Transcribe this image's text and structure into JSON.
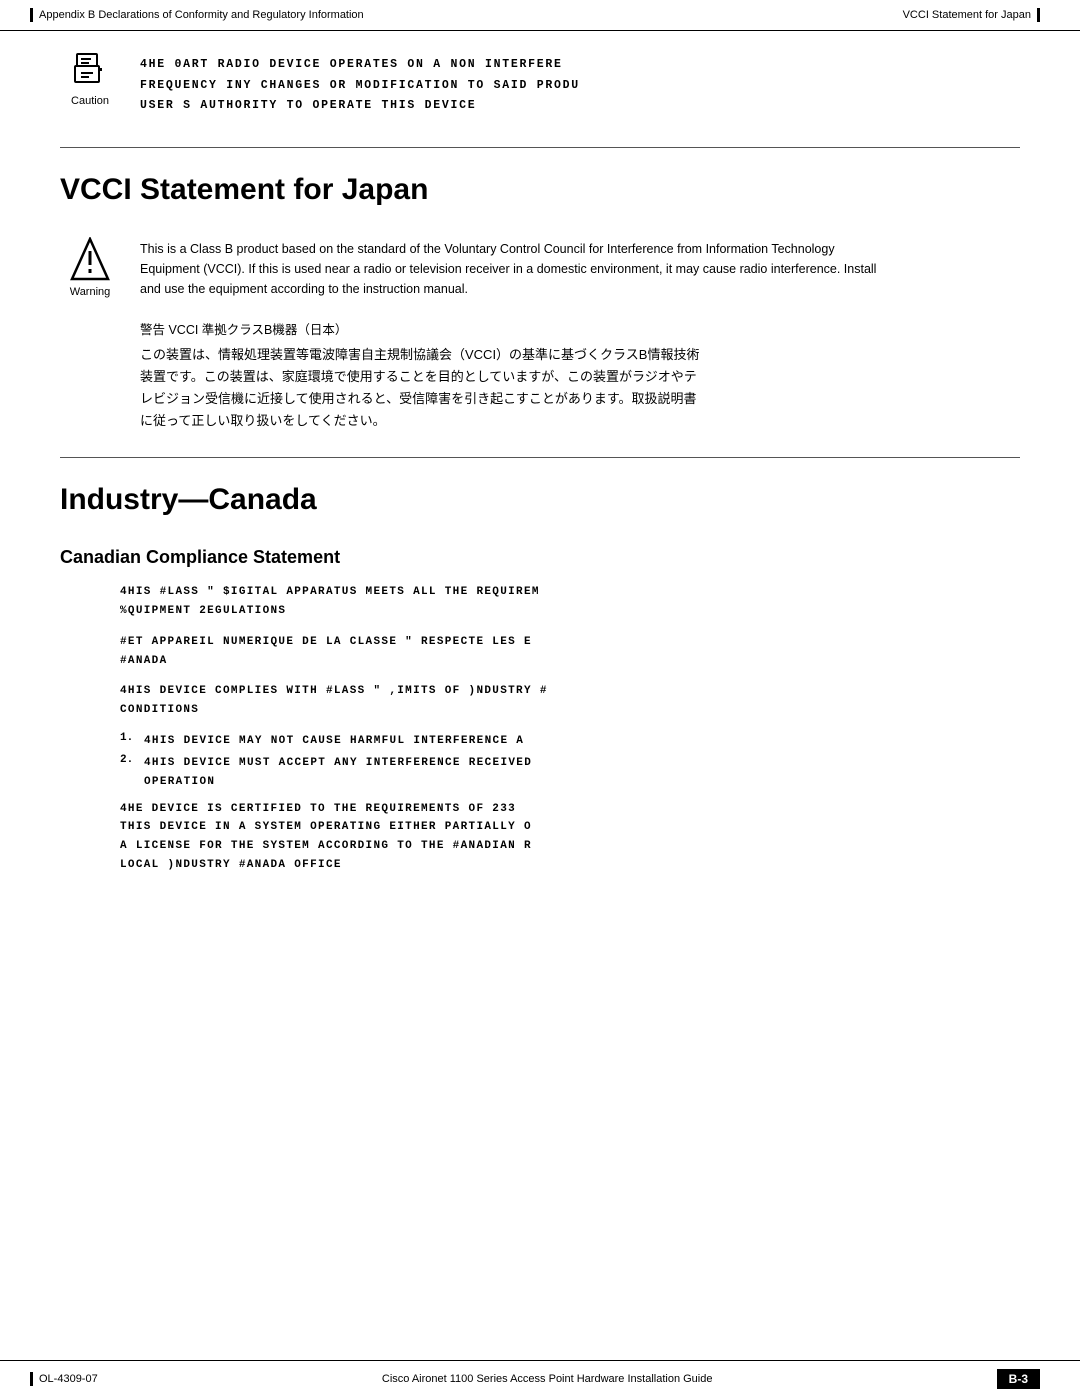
{
  "header": {
    "left_bar": true,
    "breadcrumb": "Appendix B    Declarations of Conformity and Regulatory Information",
    "right_label": "VCCI Statement for Japan",
    "right_bar": true
  },
  "caution": {
    "icon_type": "document-icon",
    "label": "Caution",
    "lines": [
      "4HE 0ART   RADIO DEVICE OPERATES ON A NON INTERFERE",
      "FREQUENCY  INY CHANGES OR MODIFICATION TO SAID PRODU",
      "USER S AUTHORITY TO OPERATE THIS DEVICE"
    ]
  },
  "vcci_section": {
    "title": "VCCI Statement for Japan",
    "warning": {
      "icon_type": "warning-triangle-icon",
      "label": "Warning",
      "text": "This is a Class B product based on the standard of the Voluntary Control Council for Interference from Information Technology Equipment (VCCI). If this is used near a radio or television receiver in a domestic environment, it may cause radio interference. Install and use the equipment according to the instruction manual."
    },
    "japanese": {
      "label": "警告    VCCI 準拠クラスB機器（日本）",
      "lines": [
        "この装置は、情報処理装置等電波障害自主規制協議会（VCCI）の基準に基づくクラスB情報技術",
        "装置です。この装置は、家庭環境で使用することを目的としていますが、この装置がラジオやテ",
        "レビジョン受信機に近接して使用されると、受信障害を引き起こすことがあります。取扱説明書",
        "に従って正しい取り扱いをしてください。"
      ]
    }
  },
  "industry_canada": {
    "title": "Industry—Canada",
    "subtitle": "Canadian Compliance Statement",
    "blocks": [
      {
        "lines": [
          "4HIS #LASS \" $IGITAL APPARATUS MEETS ALL THE REQUIREM",
          "%QUIPMENT 2EGULATIONS"
        ]
      },
      {
        "lines": [
          "#ET APPAREIL NUMERIQUE DE LA CLASSE \" RESPECTE LES E",
          "#ANADA"
        ]
      },
      {
        "lines": [
          "4HIS DEVICE COMPLIES WITH #LASS \" ,IMITS OF )NDUSTRY #",
          "CONDITIONS"
        ]
      }
    ],
    "numbered_items": [
      {
        "num": "1.",
        "lines": [
          "4HIS DEVICE MAY NOT CAUSE HARMFUL INTERFERENCE A"
        ]
      },
      {
        "num": "2.",
        "lines": [
          "4HIS DEVICE MUST ACCEPT ANY INTERFERENCE RECEIVED",
          "OPERATION"
        ]
      }
    ],
    "final_block": {
      "lines": [
        "4HE DEVICE IS CERTIFIED TO THE REQUIREMENTS OF 233",
        "THIS DEVICE IN A SYSTEM OPERATING EITHER PARTIALLY O",
        "A LICENSE FOR THE SYSTEM ACCORDING TO THE #ANADIAN R",
        "LOCAL )NDUSTRY #ANADA OFFICE"
      ]
    }
  },
  "footer": {
    "left_bar": true,
    "doc_number": "OL-4309-07",
    "center_text": "Cisco Aironet 1100 Series Access Point Hardware Installation Guide",
    "page_label": "B-3"
  }
}
